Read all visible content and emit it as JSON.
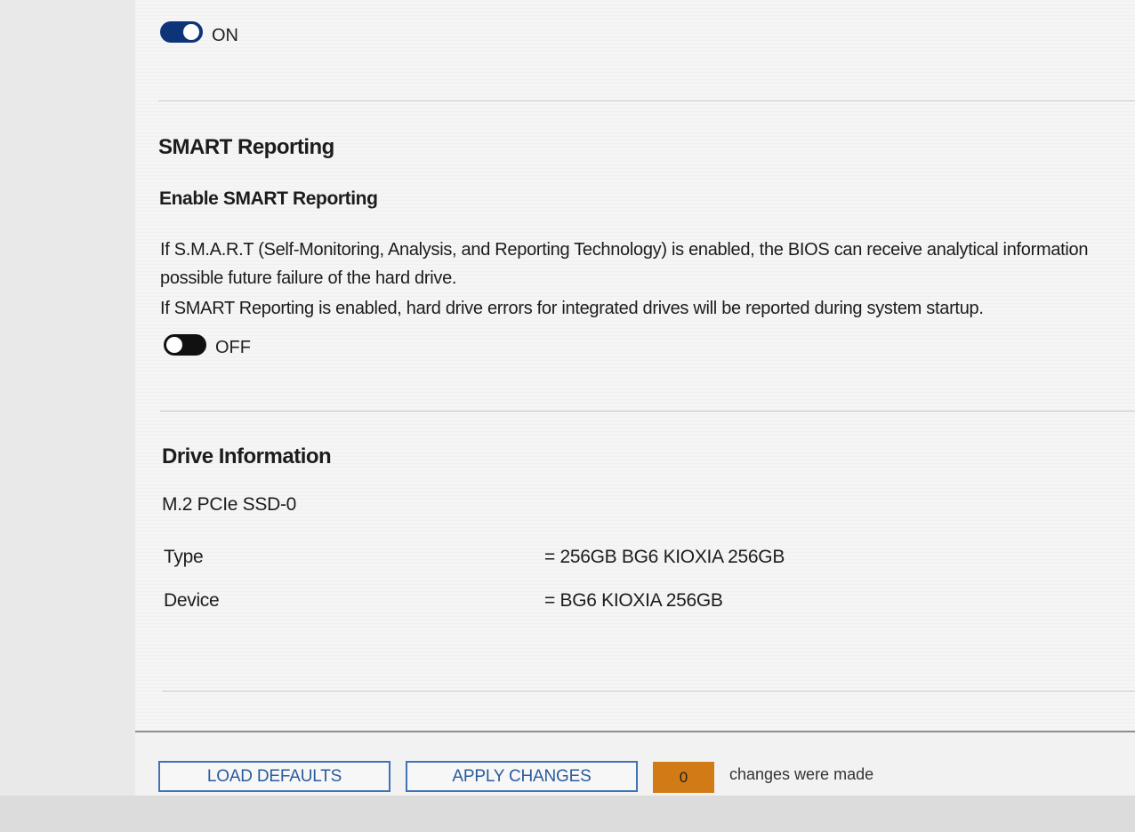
{
  "top_toggle": {
    "state_label": "ON"
  },
  "smart": {
    "section_title": "SMART Reporting",
    "setting_title": "Enable SMART Reporting",
    "description_lines": [
      "If S.M.A.R.T (Self-Monitoring, Analysis, and Reporting Technology) is enabled, the BIOS can receive analytical information",
      "possible future failure of the hard drive.",
      "If SMART Reporting is enabled, hard drive errors for integrated drives will be reported during system startup."
    ],
    "toggle_label": "OFF"
  },
  "drive_info": {
    "section_title": "Drive Information",
    "drive_name": "M.2 PCIe SSD-0",
    "rows": [
      {
        "key": "Type",
        "value": "= 256GB BG6 KIOXIA 256GB"
      },
      {
        "key": "Device",
        "value": "= BG6 KIOXIA 256GB"
      }
    ]
  },
  "footer": {
    "load_defaults_label": "LOAD DEFAULTS",
    "apply_changes_label": "APPLY CHANGES",
    "changes_count": "0",
    "changes_text": "changes were made"
  },
  "colors": {
    "toggle_on": "#0d3478",
    "toggle_off": "#111111",
    "button_border": "#3f73b8",
    "counter_bg": "#d17a16"
  }
}
